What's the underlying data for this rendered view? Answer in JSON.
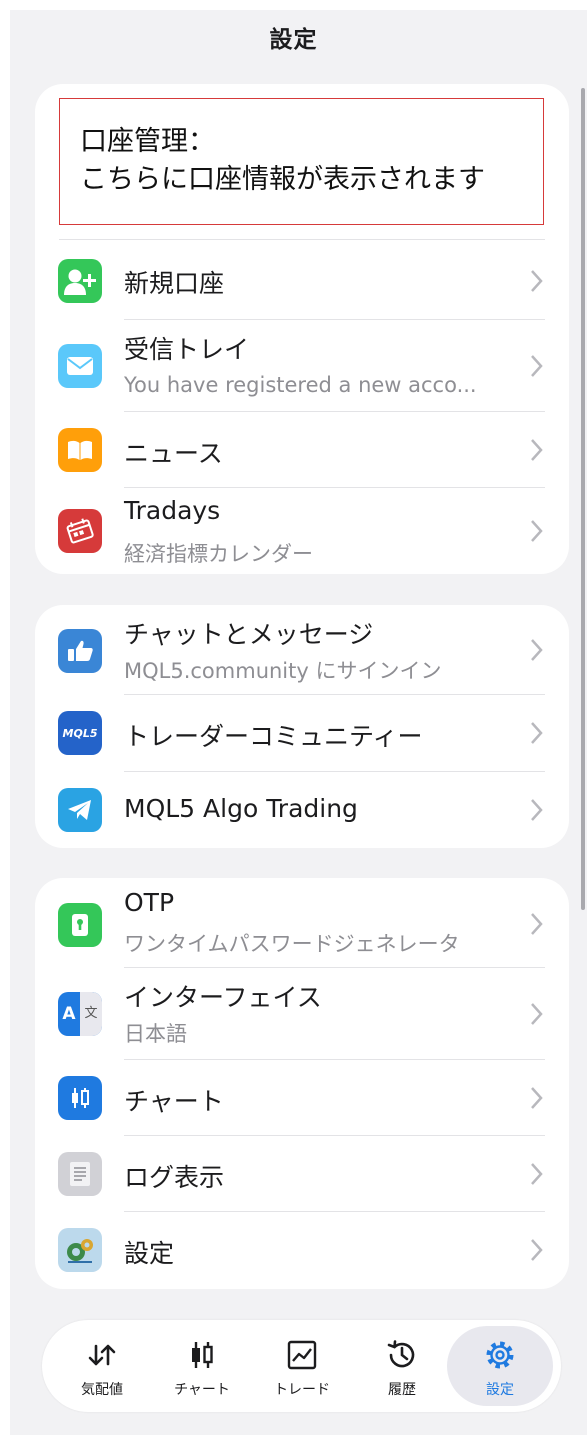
{
  "header": {
    "title": "設定"
  },
  "account": {
    "line1": "口座管理：",
    "line2": "こちらに口座情報が表示されます"
  },
  "section1": [
    {
      "title": "新規口座",
      "icon": "add-user-icon",
      "color": "#34c759"
    },
    {
      "title": "受信トレイ",
      "subtitle": "You have registered a new acco...",
      "icon": "mail-icon",
      "color": "#5ac8fa"
    },
    {
      "title": "ニュース",
      "icon": "book-icon",
      "color": "#ff9f0a"
    },
    {
      "title": "Tradays",
      "subtitle": "経済指標カレンダー",
      "icon": "tradays-calendar-icon",
      "color": "#d63a3a"
    }
  ],
  "section2": [
    {
      "title": "チャットとメッセージ",
      "subtitle": "MQL5.community にサインイン",
      "icon": "thumbs-up-icon",
      "color": "#3a86d6"
    },
    {
      "title": "トレーダーコミュニティー",
      "icon": "mql5-logo-icon",
      "color": "#2463c9",
      "badge": "MQL5"
    },
    {
      "title": "MQL5 Algo Trading",
      "icon": "telegram-icon",
      "color": "#2aa3e3"
    }
  ],
  "section3": [
    {
      "title": "OTP",
      "subtitle": "ワンタイムパスワードジェネレータ",
      "icon": "key-icon",
      "color": "#34c759"
    },
    {
      "title": "インターフェイス",
      "subtitle": "日本語",
      "icon": "translate-icon",
      "color": "#1f7ae0",
      "glyph_a": "A",
      "glyph_b": "文"
    },
    {
      "title": "チャート",
      "icon": "candlestick-icon",
      "color": "#1f7ae0"
    },
    {
      "title": "ログ表示",
      "icon": "log-icon",
      "color": "#c7c7cc"
    },
    {
      "title": "設定",
      "icon": "settings-app-icon",
      "color": "#86b8d8"
    }
  ],
  "tabbar": [
    {
      "label": "気配値",
      "icon": "quotes-arrows-icon",
      "active": false
    },
    {
      "label": "チャート",
      "icon": "candlestick-tab-icon",
      "active": false
    },
    {
      "label": "トレード",
      "icon": "trade-chart-icon",
      "active": false
    },
    {
      "label": "履歴",
      "icon": "history-icon",
      "active": false
    },
    {
      "label": "設定",
      "icon": "gear-icon",
      "active": true
    }
  ],
  "colors": {
    "accent": "#1f7ae0",
    "background": "#f2f2f4",
    "card": "#ffffff",
    "highlight_border": "#d63a3a"
  }
}
